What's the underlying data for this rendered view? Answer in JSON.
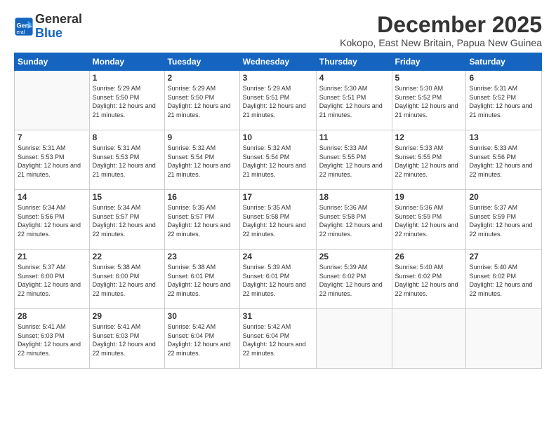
{
  "logo": {
    "line1": "General",
    "line2": "Blue"
  },
  "header": {
    "month": "December 2025",
    "location": "Kokopo, East New Britain, Papua New Guinea"
  },
  "weekdays": [
    "Sunday",
    "Monday",
    "Tuesday",
    "Wednesday",
    "Thursday",
    "Friday",
    "Saturday"
  ],
  "weeks": [
    [
      {
        "day": "",
        "empty": true
      },
      {
        "day": "1",
        "sunrise": "5:29 AM",
        "sunset": "5:50 PM",
        "daylight": "12 hours and 21 minutes."
      },
      {
        "day": "2",
        "sunrise": "5:29 AM",
        "sunset": "5:50 PM",
        "daylight": "12 hours and 21 minutes."
      },
      {
        "day": "3",
        "sunrise": "5:29 AM",
        "sunset": "5:51 PM",
        "daylight": "12 hours and 21 minutes."
      },
      {
        "day": "4",
        "sunrise": "5:30 AM",
        "sunset": "5:51 PM",
        "daylight": "12 hours and 21 minutes."
      },
      {
        "day": "5",
        "sunrise": "5:30 AM",
        "sunset": "5:52 PM",
        "daylight": "12 hours and 21 minutes."
      },
      {
        "day": "6",
        "sunrise": "5:31 AM",
        "sunset": "5:52 PM",
        "daylight": "12 hours and 21 minutes."
      }
    ],
    [
      {
        "day": "7",
        "sunrise": "5:31 AM",
        "sunset": "5:53 PM",
        "daylight": "12 hours and 21 minutes."
      },
      {
        "day": "8",
        "sunrise": "5:31 AM",
        "sunset": "5:53 PM",
        "daylight": "12 hours and 21 minutes."
      },
      {
        "day": "9",
        "sunrise": "5:32 AM",
        "sunset": "5:54 PM",
        "daylight": "12 hours and 21 minutes."
      },
      {
        "day": "10",
        "sunrise": "5:32 AM",
        "sunset": "5:54 PM",
        "daylight": "12 hours and 21 minutes."
      },
      {
        "day": "11",
        "sunrise": "5:33 AM",
        "sunset": "5:55 PM",
        "daylight": "12 hours and 22 minutes."
      },
      {
        "day": "12",
        "sunrise": "5:33 AM",
        "sunset": "5:55 PM",
        "daylight": "12 hours and 22 minutes."
      },
      {
        "day": "13",
        "sunrise": "5:33 AM",
        "sunset": "5:56 PM",
        "daylight": "12 hours and 22 minutes."
      }
    ],
    [
      {
        "day": "14",
        "sunrise": "5:34 AM",
        "sunset": "5:56 PM",
        "daylight": "12 hours and 22 minutes."
      },
      {
        "day": "15",
        "sunrise": "5:34 AM",
        "sunset": "5:57 PM",
        "daylight": "12 hours and 22 minutes."
      },
      {
        "day": "16",
        "sunrise": "5:35 AM",
        "sunset": "5:57 PM",
        "daylight": "12 hours and 22 minutes."
      },
      {
        "day": "17",
        "sunrise": "5:35 AM",
        "sunset": "5:58 PM",
        "daylight": "12 hours and 22 minutes."
      },
      {
        "day": "18",
        "sunrise": "5:36 AM",
        "sunset": "5:58 PM",
        "daylight": "12 hours and 22 minutes."
      },
      {
        "day": "19",
        "sunrise": "5:36 AM",
        "sunset": "5:59 PM",
        "daylight": "12 hours and 22 minutes."
      },
      {
        "day": "20",
        "sunrise": "5:37 AM",
        "sunset": "5:59 PM",
        "daylight": "12 hours and 22 minutes."
      }
    ],
    [
      {
        "day": "21",
        "sunrise": "5:37 AM",
        "sunset": "6:00 PM",
        "daylight": "12 hours and 22 minutes."
      },
      {
        "day": "22",
        "sunrise": "5:38 AM",
        "sunset": "6:00 PM",
        "daylight": "12 hours and 22 minutes."
      },
      {
        "day": "23",
        "sunrise": "5:38 AM",
        "sunset": "6:01 PM",
        "daylight": "12 hours and 22 minutes."
      },
      {
        "day": "24",
        "sunrise": "5:39 AM",
        "sunset": "6:01 PM",
        "daylight": "12 hours and 22 minutes."
      },
      {
        "day": "25",
        "sunrise": "5:39 AM",
        "sunset": "6:02 PM",
        "daylight": "12 hours and 22 minutes."
      },
      {
        "day": "26",
        "sunrise": "5:40 AM",
        "sunset": "6:02 PM",
        "daylight": "12 hours and 22 minutes."
      },
      {
        "day": "27",
        "sunrise": "5:40 AM",
        "sunset": "6:02 PM",
        "daylight": "12 hours and 22 minutes."
      }
    ],
    [
      {
        "day": "28",
        "sunrise": "5:41 AM",
        "sunset": "6:03 PM",
        "daylight": "12 hours and 22 minutes."
      },
      {
        "day": "29",
        "sunrise": "5:41 AM",
        "sunset": "6:03 PM",
        "daylight": "12 hours and 22 minutes."
      },
      {
        "day": "30",
        "sunrise": "5:42 AM",
        "sunset": "6:04 PM",
        "daylight": "12 hours and 22 minutes."
      },
      {
        "day": "31",
        "sunrise": "5:42 AM",
        "sunset": "6:04 PM",
        "daylight": "12 hours and 22 minutes."
      },
      {
        "day": "",
        "empty": true
      },
      {
        "day": "",
        "empty": true
      },
      {
        "day": "",
        "empty": true
      }
    ]
  ]
}
